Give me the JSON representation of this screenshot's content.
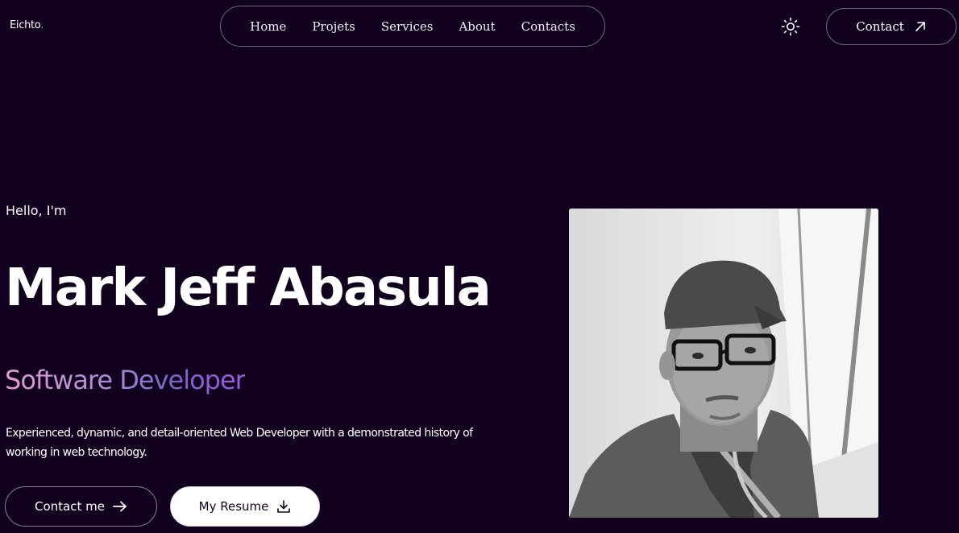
{
  "brand": {
    "logo": "Eichto",
    "logo_dot": "."
  },
  "nav": {
    "items": [
      {
        "label": "Home"
      },
      {
        "label": "Projets"
      },
      {
        "label": "Services"
      },
      {
        "label": "About"
      },
      {
        "label": "Contacts"
      }
    ]
  },
  "header": {
    "theme_icon": "sun-icon",
    "contact_label": "Contact",
    "contact_icon": "arrow-up-right-icon"
  },
  "hero": {
    "greeting": "Hello, I'm",
    "name": "Mark Jeff Abasula",
    "role": "Software Developer",
    "bio": "Experienced, dynamic, and detail-oriented Web Developer with a demonstrated history of working in web technology.",
    "contact_button": "Contact me",
    "contact_button_icon": "arrow-right-icon",
    "resume_button": "My Resume",
    "resume_button_icon": "download-icon"
  },
  "colors": {
    "background": "#12001f",
    "text": "#ffffff",
    "role_gradient": [
      "#e39cd0",
      "#a98bd6",
      "#7d63c4",
      "#9b5ce0"
    ]
  },
  "profile_photo": {
    "icon": "profile-photo"
  }
}
